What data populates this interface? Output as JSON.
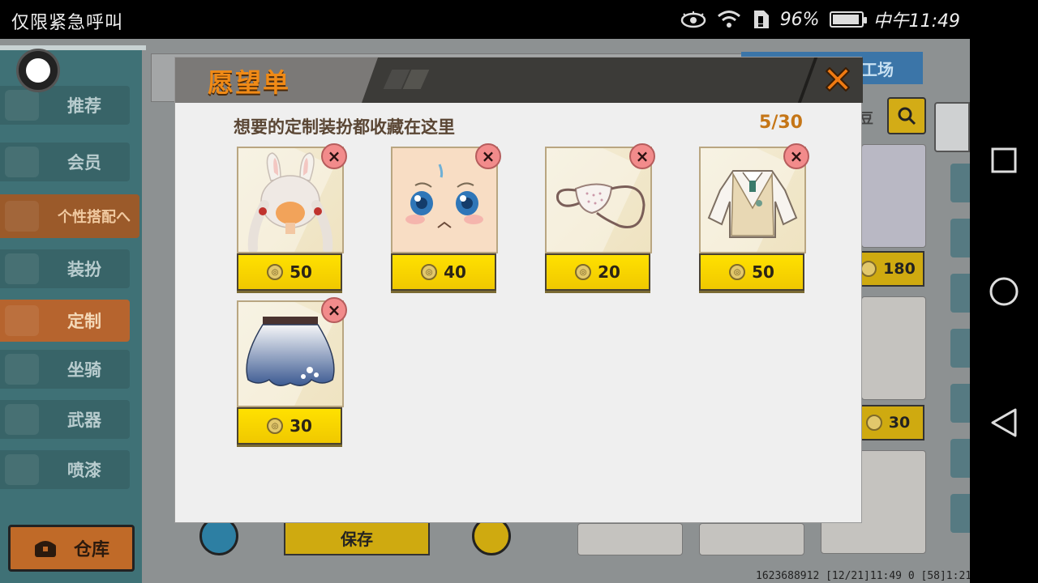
{
  "status_bar": {
    "carrier": "仅限紧急呼叫",
    "battery_percent": "96%",
    "battery_level": 0.96,
    "time": "中午11:49",
    "icons": [
      "eye-icon",
      "wifi-icon",
      "sim-icon",
      "battery-icon"
    ]
  },
  "nav_bar": {
    "buttons": [
      "recents-button",
      "home-button",
      "back-button"
    ]
  },
  "sidebar": {
    "items": [
      {
        "label": "推荐"
      },
      {
        "label": "会员"
      },
      {
        "label": "个性搭配へ"
      },
      {
        "label": "装扮"
      },
      {
        "label": "定制"
      },
      {
        "label": "坐骑"
      },
      {
        "label": "武器"
      },
      {
        "label": "喷漆"
      }
    ],
    "warehouse_label": "仓库"
  },
  "background": {
    "tab_label": "工场",
    "search_label": "豆",
    "prices": [
      "180",
      "30"
    ],
    "save_label": "保存",
    "footer": "1623688912   [12/21]11:49 0    [58]1:21"
  },
  "wishlist": {
    "title": "愿望单",
    "subtitle": "想要的定制装扮都收藏在这里",
    "count": "5/30",
    "items": [
      {
        "name": "bunny-hair",
        "price": "50"
      },
      {
        "name": "face-expression",
        "price": "40"
      },
      {
        "name": "face-mask",
        "price": "20"
      },
      {
        "name": "sweater-vest",
        "price": "50"
      },
      {
        "name": "skirt",
        "price": "30"
      }
    ],
    "remove_symbol": "×"
  },
  "colors": {
    "title_orange": "#f08a16",
    "price_yellow": "#ffe100",
    "remove_pink": "#f28b8b",
    "sidebar_teal": "#3f7176",
    "active_orange": "#b6642e"
  }
}
